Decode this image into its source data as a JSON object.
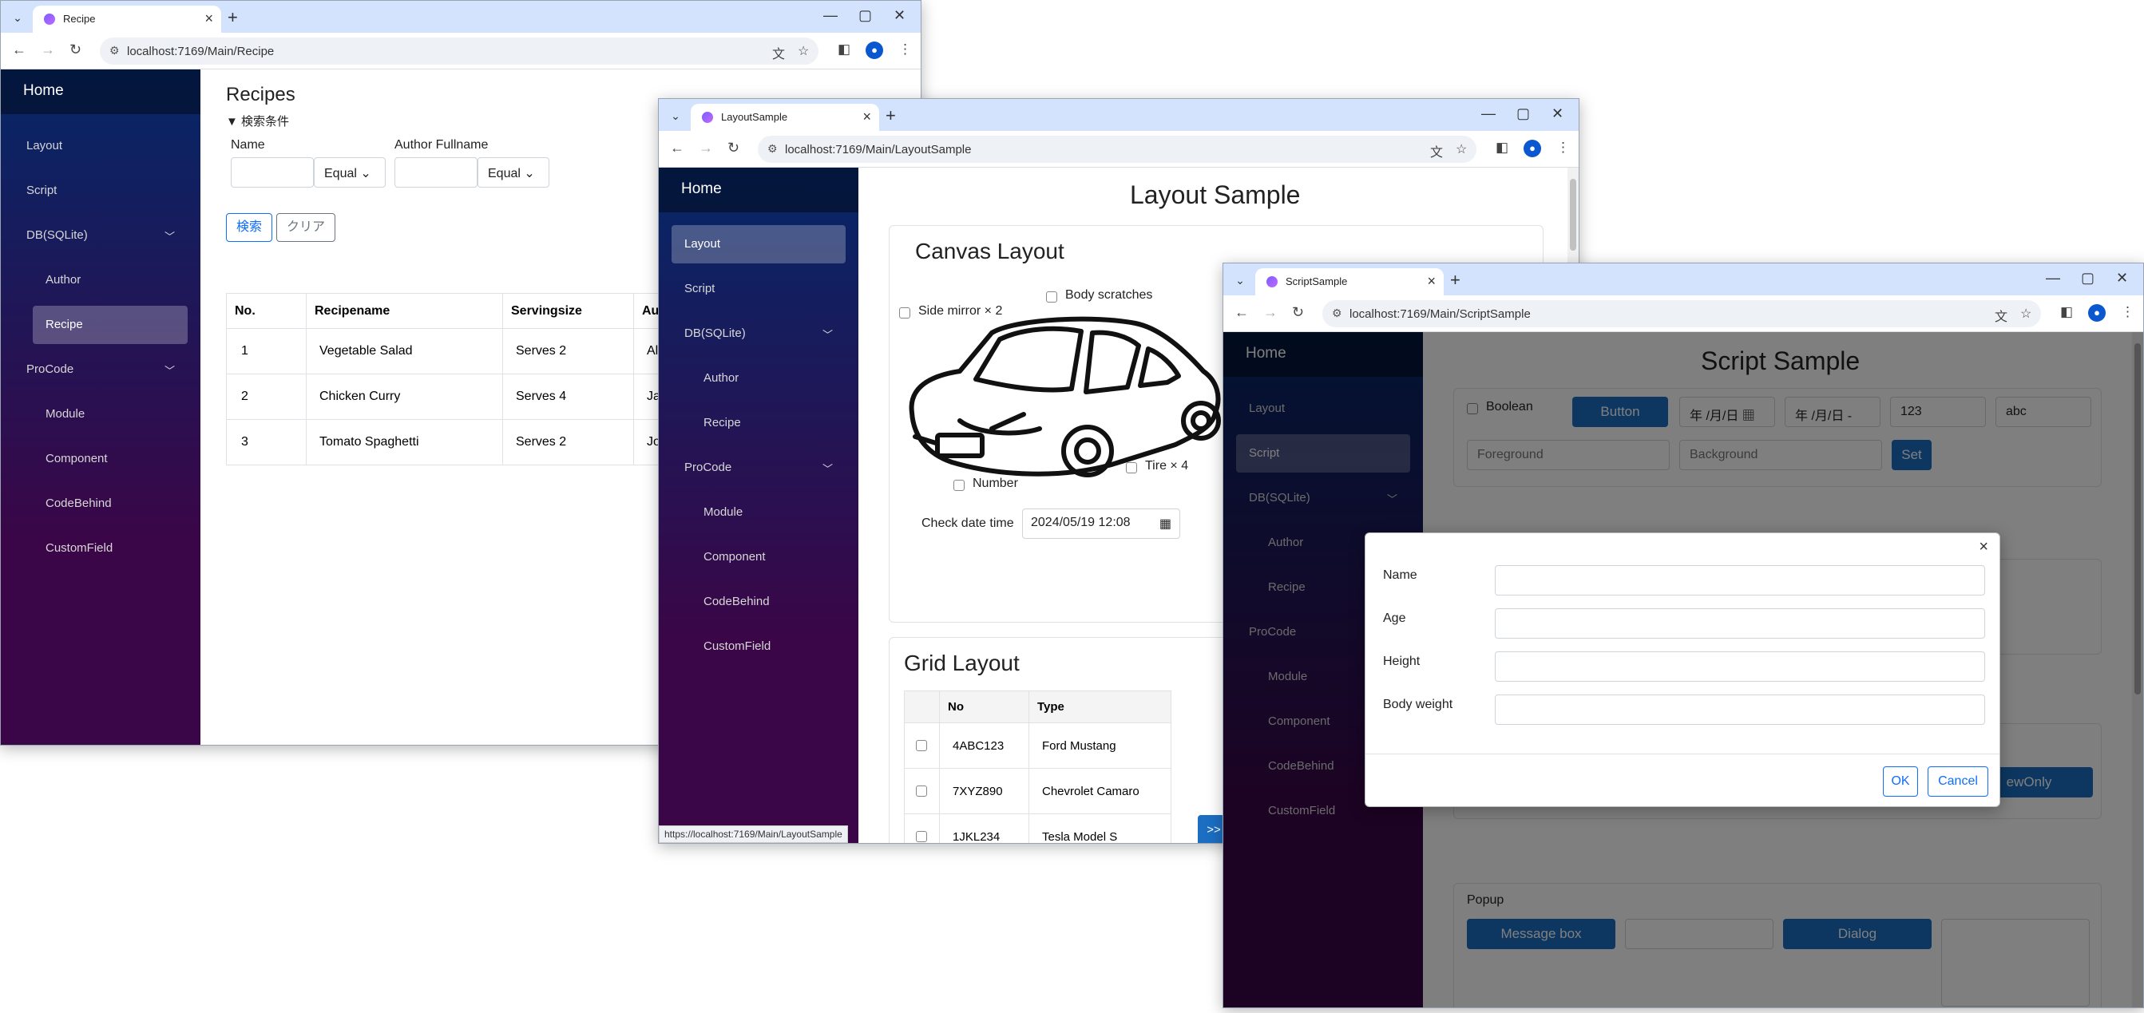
{
  "nav_common": {
    "home": "Home",
    "layout": "Layout",
    "script": "Script",
    "db": "DB(SQLite)",
    "author": "Author",
    "recipe": "Recipe",
    "procode": "ProCode",
    "module": "Module",
    "component": "Component",
    "codebehind": "CodeBehind",
    "customfield": "CustomField"
  },
  "win1": {
    "tab_title": "Recipe",
    "url": "localhost:7169/Main/Recipe",
    "heading": "Recipes",
    "filter_toggle": "▼ 検索条件",
    "name_label": "Name",
    "author_label": "Author Fullname",
    "equal": "Equal",
    "search_btn": "検索",
    "clear_btn": "クリア",
    "columns": [
      "No.",
      "Recipename",
      "Servingsize",
      "Au"
    ],
    "rows": [
      [
        "1",
        "Vegetable Salad",
        "Serves 2",
        "Al"
      ],
      [
        "2",
        "Chicken Curry",
        "Serves 4",
        "Ja"
      ],
      [
        "3",
        "Tomato Spaghetti",
        "Serves 2",
        "Jo"
      ]
    ]
  },
  "win2": {
    "tab_title": "LayoutSample",
    "url": "localhost:7169/Main/LayoutSample",
    "title": "Layout Sample",
    "canvas_title": "Canvas Layout",
    "side_mirror": "Side mirror × 2",
    "body_scratches": "Body scratches",
    "number": "Number",
    "tire": "Tire × 4",
    "check_date_label": "Check date time",
    "check_date_value": "2024/05/19 12:08",
    "grid_title": "Grid Layout",
    "grid_columns": [
      "",
      "No",
      "Type"
    ],
    "grid_rows": [
      [
        "4ABC123",
        "Ford Mustang"
      ],
      [
        "7XYZ890",
        "Chevrolet Camaro"
      ],
      [
        "1JKL234",
        "Tesla Model S"
      ]
    ],
    "next_btn": ">>",
    "status_url": "https://localhost:7169/Main/LayoutSample"
  },
  "win3": {
    "tab_title": "ScriptSample",
    "url": "localhost:7169/Main/ScriptSample",
    "title": "Script Sample",
    "boolean_label": "Boolean",
    "button_label": "Button",
    "date1": "年 /月/日",
    "date2": "年 /月/日 -",
    "num_value": "123",
    "text_value": "abc",
    "fg_placeholder": "Foreground",
    "bg_placeholder": "Background",
    "set_btn": "Set",
    "readonly_btn_partial": "ewOnly",
    "popup_label": "Popup",
    "message_box_btn": "Message box",
    "dialog_btn": "Dialog",
    "dialog": {
      "fields": [
        "Name",
        "Age",
        "Height",
        "Body weight"
      ],
      "ok": "OK",
      "cancel": "Cancel"
    }
  }
}
